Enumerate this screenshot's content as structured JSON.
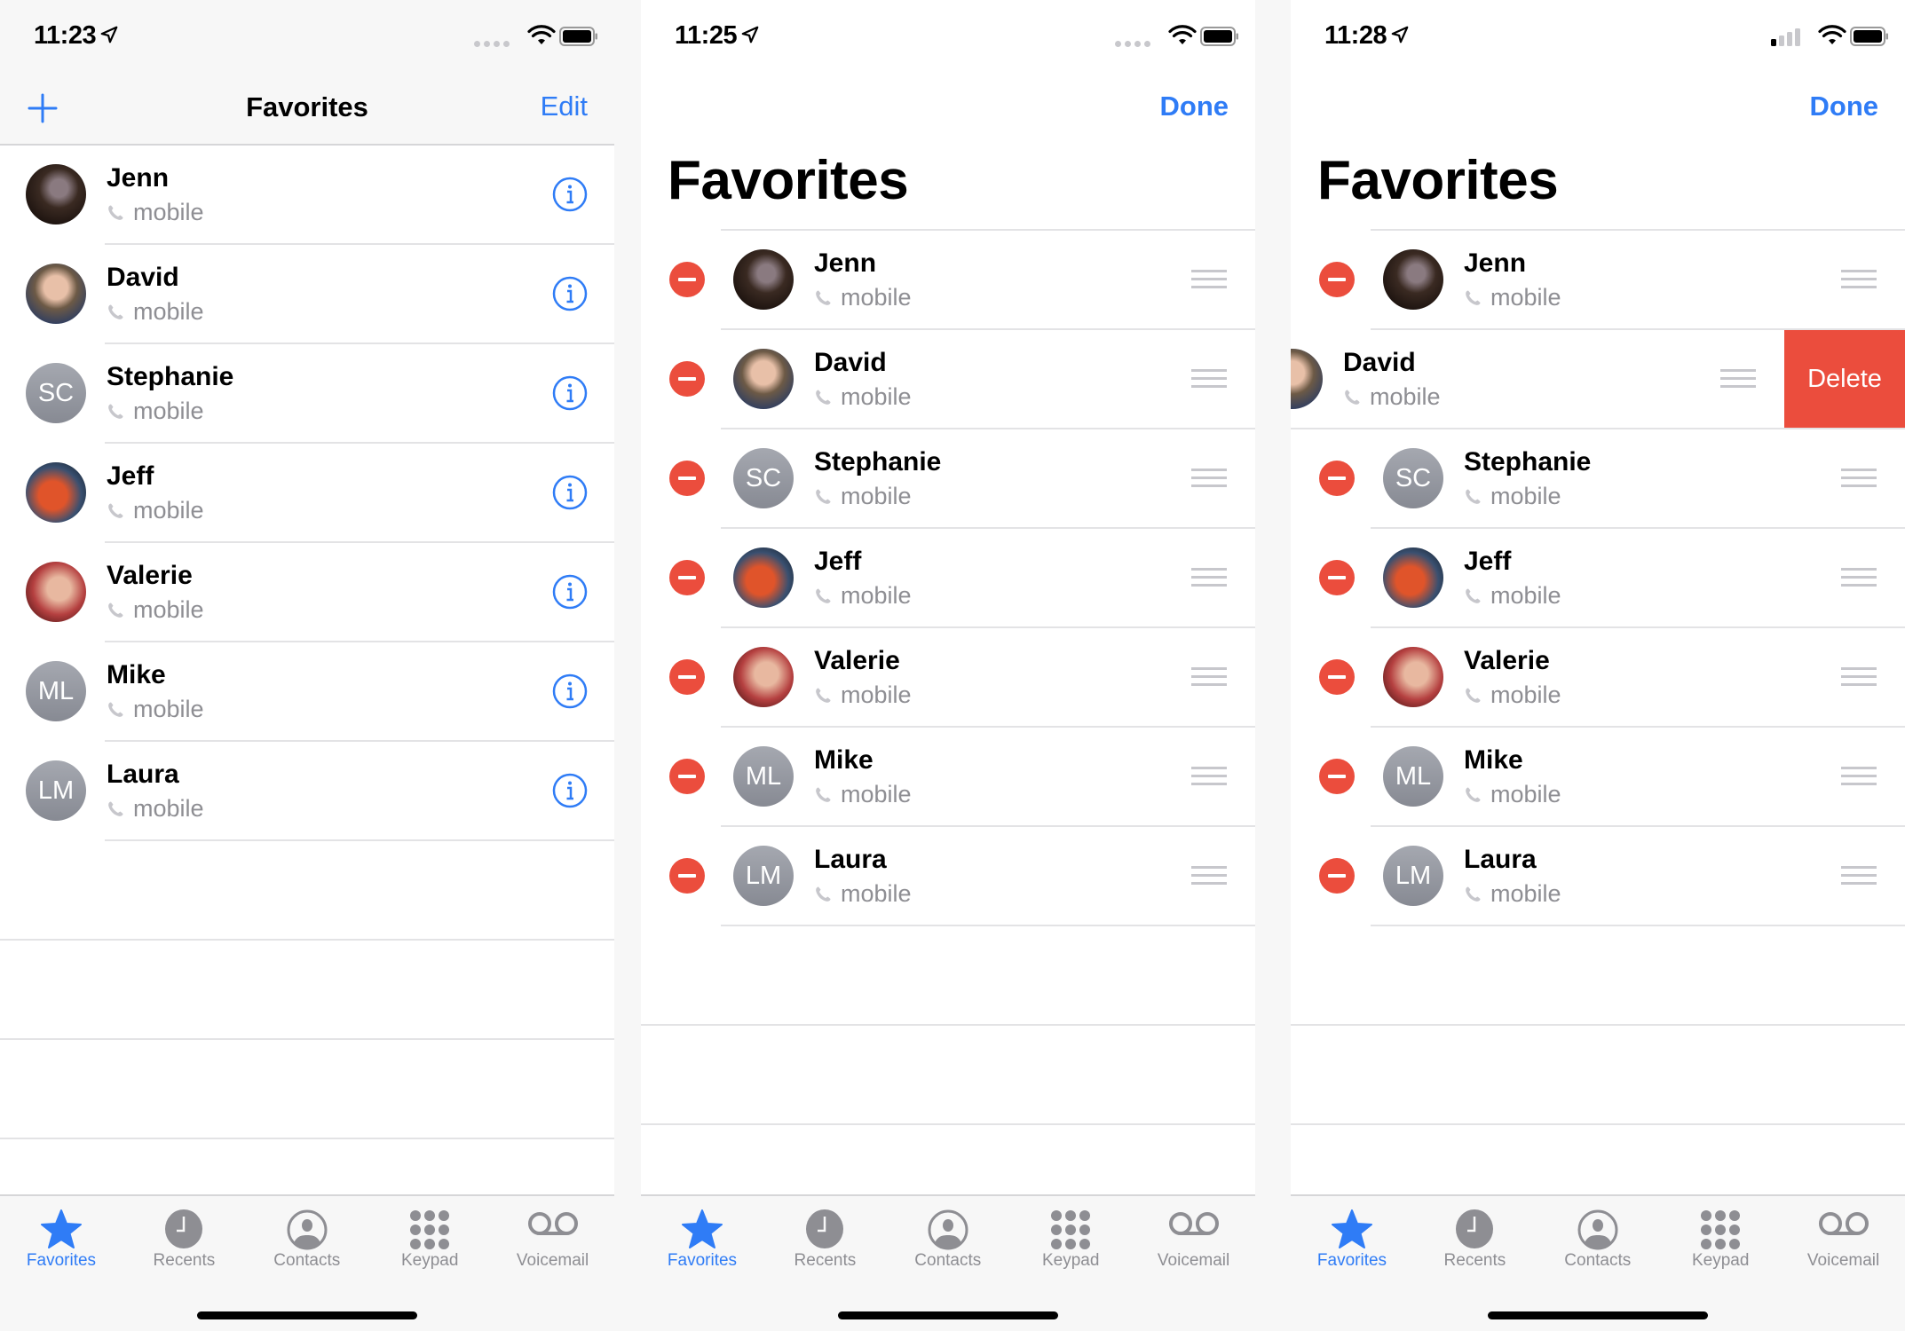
{
  "colors": {
    "accent": "#2f7cf6",
    "destructive": "#eb4d3d",
    "secondary_text": "#8e8e93"
  },
  "panels": [
    {
      "status": {
        "time": "11:23",
        "signal": "no-service-dots"
      },
      "nav": {
        "title": "Favorites",
        "left_icon": "plus-icon",
        "right_label": "Edit"
      },
      "mode": "normal",
      "contacts": [
        {
          "name": "Jenn",
          "type": "mobile",
          "avatar": "photo"
        },
        {
          "name": "David",
          "type": "mobile",
          "avatar": "photo"
        },
        {
          "name": "Stephanie",
          "type": "mobile",
          "avatar": "SC"
        },
        {
          "name": "Jeff",
          "type": "mobile",
          "avatar": "photo"
        },
        {
          "name": "Valerie",
          "type": "mobile",
          "avatar": "photo"
        },
        {
          "name": "Mike",
          "type": "mobile",
          "avatar": "ML"
        },
        {
          "name": "Laura",
          "type": "mobile",
          "avatar": "LM"
        }
      ]
    },
    {
      "status": {
        "time": "11:25",
        "signal": "no-service-dots"
      },
      "nav": {
        "title": "Favorites",
        "right_label": "Done"
      },
      "mode": "edit",
      "contacts": [
        {
          "name": "Jenn",
          "type": "mobile",
          "avatar": "photo"
        },
        {
          "name": "David",
          "type": "mobile",
          "avatar": "photo"
        },
        {
          "name": "Stephanie",
          "type": "mobile",
          "avatar": "SC"
        },
        {
          "name": "Jeff",
          "type": "mobile",
          "avatar": "photo"
        },
        {
          "name": "Valerie",
          "type": "mobile",
          "avatar": "photo"
        },
        {
          "name": "Mike",
          "type": "mobile",
          "avatar": "ML"
        },
        {
          "name": "Laura",
          "type": "mobile",
          "avatar": "LM"
        }
      ]
    },
    {
      "status": {
        "time": "11:28",
        "signal": "1-of-4-bars"
      },
      "nav": {
        "title": "Favorites",
        "right_label": "Done"
      },
      "mode": "edit-swiped",
      "delete_label": "Delete",
      "swiped_contact": "David",
      "contacts": [
        {
          "name": "Jenn",
          "type": "mobile",
          "avatar": "photo"
        },
        {
          "name": "David",
          "type": "mobile",
          "avatar": "photo"
        },
        {
          "name": "Stephanie",
          "type": "mobile",
          "avatar": "SC"
        },
        {
          "name": "Jeff",
          "type": "mobile",
          "avatar": "photo"
        },
        {
          "name": "Valerie",
          "type": "mobile",
          "avatar": "photo"
        },
        {
          "name": "Mike",
          "type": "mobile",
          "avatar": "ML"
        },
        {
          "name": "Laura",
          "type": "mobile",
          "avatar": "LM"
        }
      ]
    }
  ],
  "tabs": [
    {
      "label": "Favorites",
      "icon": "star-icon",
      "active": true
    },
    {
      "label": "Recents",
      "icon": "clock-icon",
      "active": false
    },
    {
      "label": "Contacts",
      "icon": "person-circle-icon",
      "active": false
    },
    {
      "label": "Keypad",
      "icon": "keypad-icon",
      "active": false
    },
    {
      "label": "Voicemail",
      "icon": "voicemail-icon",
      "active": false
    }
  ]
}
